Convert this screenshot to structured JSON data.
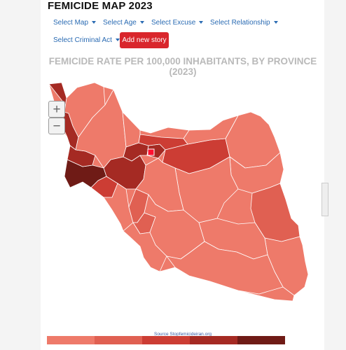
{
  "header": {
    "title": "FEMICIDE MAP 2023"
  },
  "toolbar": {
    "select_map": "Select Map",
    "select_age": "Select Age",
    "select_excuse": "Select Excuse",
    "select_relationship": "Select Relationship",
    "select_criminal_act": "Select Criminal Act",
    "add_story": "Add new story"
  },
  "map": {
    "title": "FEMICIDE RATE PER 100,000 INHABITANTS, BY PROVINCE (2023)",
    "zoom_in": "+",
    "zoom_out": "−",
    "source": "Source Stopfemicideiran.org"
  },
  "colors": {
    "background": "#f4f4f4",
    "accent": "#d9262c",
    "link": "#2a6bb3",
    "level_1": "#ee7a6a",
    "level_2": "#e06052",
    "level_3": "#cc3d34",
    "level_4": "#a52a23",
    "level_5": "#6f1b16",
    "highlight": "#ff1030"
  },
  "legend": {
    "levels": [
      "#ee7a6a",
      "#e06052",
      "#cc3d34",
      "#a52a23",
      "#6f1b16"
    ]
  }
}
